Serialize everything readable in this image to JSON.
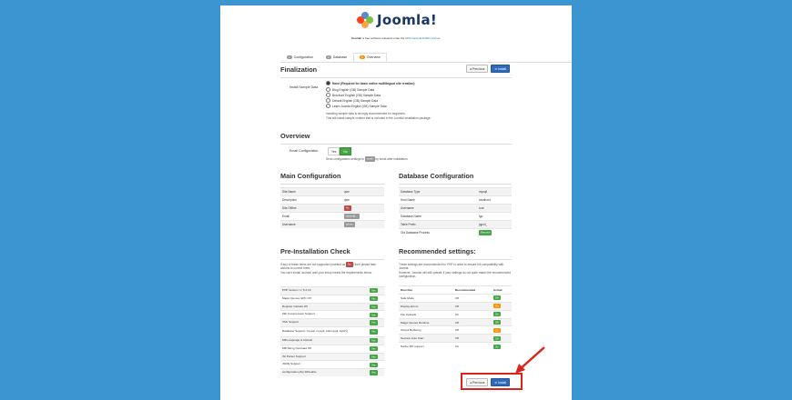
{
  "header": {
    "logo_text": "Joomla!",
    "license_bold": "Joomla!",
    "license_mid": " is free software released under the ",
    "license_link": "GNU General Public License",
    "license_end": "."
  },
  "steps": [
    {
      "num": "1",
      "label": "Configuration"
    },
    {
      "num": "2",
      "label": "Database"
    },
    {
      "num": "3",
      "label": "Overview"
    }
  ],
  "buttons": {
    "previous": "◂ Previous",
    "install": "➜ Install"
  },
  "finalization": {
    "title": "Finalization",
    "sample_label": "Install Sample Data",
    "options": [
      "None (Required for basic native multilingual site creation)",
      "Blog English (GB) Sample Data",
      "Brochure English (GB) Sample Data",
      "Default English (GB) Sample Data",
      "Learn Joomla English (GB) Sample Data"
    ],
    "help_line1": "Installing sample data is strongly recommended for beginners.",
    "help_line2": "This will install sample content that is included in the Joomla! installation package."
  },
  "overview": {
    "title": "Overview",
    "email_label": "Email Configuration",
    "no": "Yes",
    "yes": "No",
    "help_pre": "Send configuration settings to",
    "help_badge": "email",
    "help_post": "by email after installation."
  },
  "main_config": {
    "title": "Main Configuration",
    "rows": [
      {
        "k": "Site Name",
        "v": "qwe"
      },
      {
        "k": "Description",
        "v": "qwe"
      },
      {
        "k": "Site Offline",
        "v": "No"
      },
      {
        "k": "Email",
        "v": "admin@..."
      },
      {
        "k": "Username",
        "v": "admin"
      }
    ]
  },
  "db_config": {
    "title": "Database Configuration",
    "rows": [
      {
        "k": "Database Type",
        "v": "mysqli"
      },
      {
        "k": "Host Name",
        "v": "localhost"
      },
      {
        "k": "Username",
        "v": "root"
      },
      {
        "k": "Database Name",
        "v": "tgo"
      },
      {
        "k": "Table Prefix",
        "v": "jqpx4_"
      },
      {
        "k": "Old Database Process",
        "v": "Remove"
      }
    ]
  },
  "pre_check": {
    "title": "Pre-Installation Check",
    "intro_1": "If any of these items are not supported (marked as",
    "intro_badge": "No",
    "intro_2": ") then please take actions to correct them.",
    "intro_3": "You can't install Joomla! until your setup meets the requirements below.",
    "rows": [
      {
        "k": "PHP Version >= 5.3.10",
        "v": "Yes"
      },
      {
        "k": "Magic Quotes GPC Off",
        "v": "Yes"
      },
      {
        "k": "Register Globals Off",
        "v": "Yes"
      },
      {
        "k": "Zlib Compression Support",
        "v": "Yes"
      },
      {
        "k": "XML Support",
        "v": "Yes"
      },
      {
        "k": "Database Support: (mysql, mysqli, pdomysql, sqlsrv)",
        "v": "Yes"
      },
      {
        "k": "MB Language is Default",
        "v": "Yes"
      },
      {
        "k": "MB String Overload Off",
        "v": "Yes"
      },
      {
        "k": "INI Parser Support",
        "v": "Yes"
      },
      {
        "k": "JSON Support",
        "v": "Yes"
      },
      {
        "k": "configuration.php Writeable",
        "v": "Yes"
      }
    ]
  },
  "recommended": {
    "title": "Recommended settings:",
    "intro_1": "These settings are recommended for PHP in order to ensure full compatibility with Joomla.",
    "intro_2": "However, Joomla! will still operate if your settings do not quite match the recommended configuration.",
    "head": {
      "c1": "Directive",
      "c2": "Recommended",
      "c3": "Actual"
    },
    "rows": [
      {
        "c1": "Safe Mode",
        "c2": "Off",
        "c3": "Off",
        "ok": true
      },
      {
        "c1": "Display Errors",
        "c2": "Off",
        "c3": "On",
        "ok": false
      },
      {
        "c1": "File Uploads",
        "c2": "On",
        "c3": "On",
        "ok": true
      },
      {
        "c1": "Magic Quotes Runtime",
        "c2": "Off",
        "c3": "Off",
        "ok": true
      },
      {
        "c1": "Output Buffering",
        "c2": "Off",
        "c3": "On",
        "ok": false
      },
      {
        "c1": "Session Auto Start",
        "c2": "Off",
        "c3": "Off",
        "ok": true
      },
      {
        "c1": "Native ZIP support",
        "c2": "On",
        "c3": "On",
        "ok": true
      }
    ]
  },
  "colors": {
    "background": "#3b95d1",
    "primary_button": "#2f6ab8",
    "success": "#46a546",
    "warning": "#f89406",
    "highlight": "#d9251d"
  }
}
